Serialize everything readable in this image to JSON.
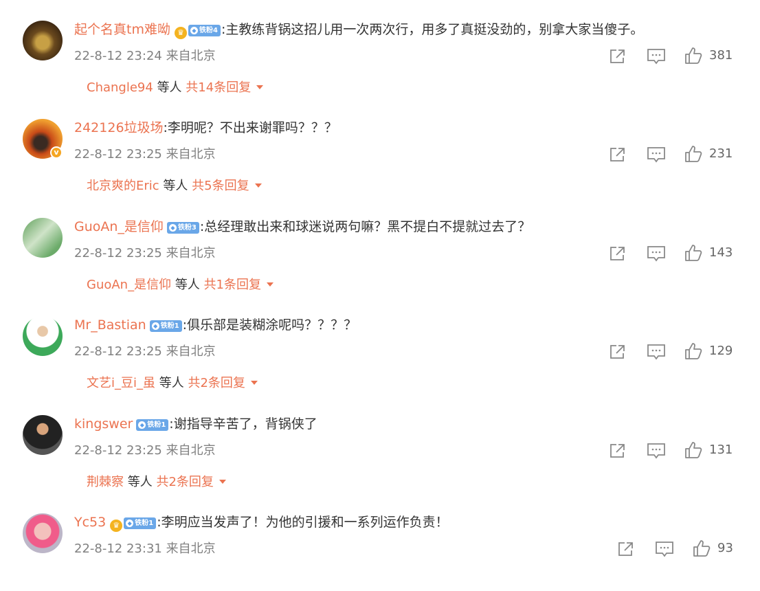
{
  "comments": [
    {
      "username": "起个名真tm难呦",
      "badge": "铁粉4",
      "badge_type": "crown",
      "text": ":主教练背锅这招儿用一次两次行，用多了真挺没劲的，别拿大家当傻子。",
      "time": "22-8-12 23:24 来自北京",
      "likes": "381",
      "reply_name": "Changle94",
      "reply_mid": "等人",
      "reply_total": "共14条回复",
      "verified": false
    },
    {
      "username": "242126垃圾场",
      "badge": "",
      "badge_type": "none",
      "text": ":李明呢？不出来谢罪吗？？？",
      "time": "22-8-12 23:25 来自北京",
      "likes": "231",
      "reply_name": "北京爽的Eric",
      "reply_mid": "等人",
      "reply_total": "共5条回复",
      "verified": true
    },
    {
      "username": "GuoAn_是信仰",
      "badge": "铁粉3",
      "badge_type": "diamond",
      "text": ":总经理敢出来和球迷说两句嘛？黑不提白不提就过去了？",
      "time": "22-8-12 23:25 来自北京",
      "likes": "143",
      "reply_name": "GuoAn_是信仰",
      "reply_mid": "等人",
      "reply_total": "共1条回复",
      "verified": false
    },
    {
      "username": "Mr_Bastian",
      "badge": "铁粉1",
      "badge_type": "diamond",
      "text": ":俱乐部是装糊涂呢吗？？？？",
      "time": "22-8-12 23:25 来自北京",
      "likes": "129",
      "reply_name": "文艺i_豆i_虽",
      "reply_mid": "等人",
      "reply_total": "共2条回复",
      "verified": false
    },
    {
      "username": "kingswer",
      "badge": "铁粉1",
      "badge_type": "diamond",
      "text": ":谢指导辛苦了，背锅侠了",
      "time": "22-8-12 23:25 来自北京",
      "likes": "131",
      "reply_name": "荆棘察",
      "reply_mid": "等人",
      "reply_total": "共2条回复",
      "verified": false
    },
    {
      "username": "Yc53",
      "badge": "铁粉1",
      "badge_type": "crown",
      "text": ":李明应当发声了！为他的引援和一系列运作负责！",
      "time": "22-8-12 23:31 来自北京",
      "likes": "93",
      "reply_name": "",
      "reply_mid": "",
      "reply_total": "",
      "verified": false
    }
  ],
  "colors": {
    "accent": "#eb7350",
    "badge": "#5c9ee8",
    "meta": "#808080"
  }
}
